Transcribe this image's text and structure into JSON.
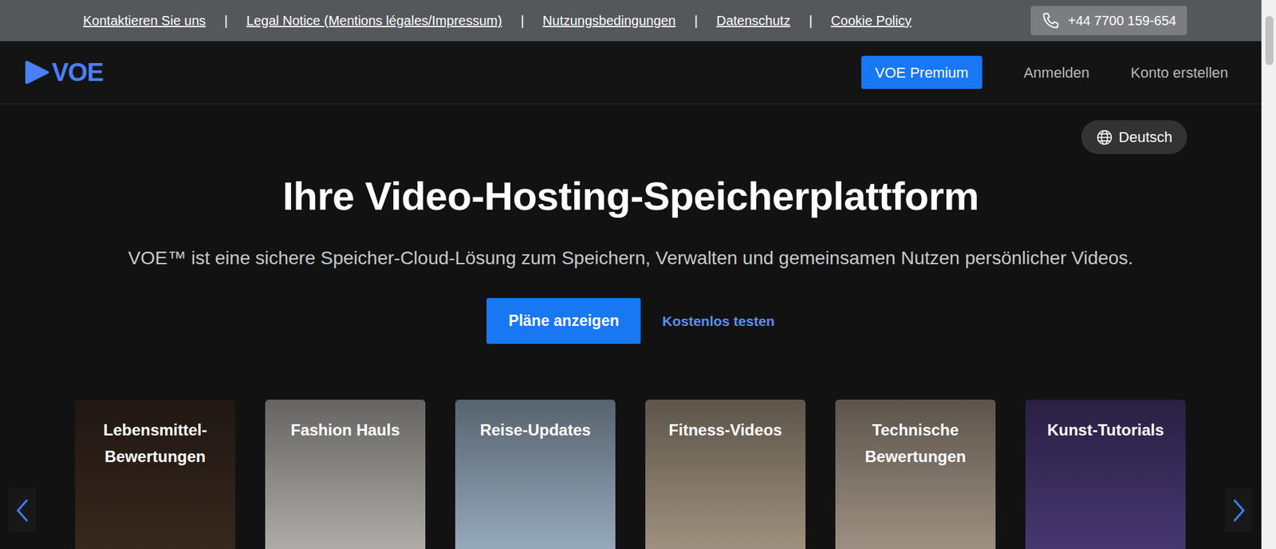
{
  "top_bar": {
    "links": [
      {
        "label": "Kontaktieren Sie uns"
      },
      {
        "label": "Legal Notice (Mentions légales/Impressum)"
      },
      {
        "label": "Nutzungsbedingungen"
      },
      {
        "label": "Datenschutz"
      },
      {
        "label": "Cookie Policy"
      }
    ],
    "separator": "|",
    "phone": "+44 7700 159-654"
  },
  "logo": "VOE",
  "nav": {
    "premium": "VOE Premium",
    "login": "Anmelden",
    "signup": "Konto erstellen"
  },
  "language": "Deutsch",
  "hero": {
    "title": "Ihre Video-Hosting-Speicherplattform",
    "subtitle": "VOE™ ist eine sichere Speicher-Cloud-Lösung zum Speichern, Verwalten und gemeinsamen Nutzen persönlicher Videos.",
    "primary_button": "Pläne anzeigen",
    "secondary_button": "Kostenlos testen"
  },
  "carousel": {
    "cards": [
      {
        "title": "Lebensmittel-Bewertungen",
        "color": "#3a2a20"
      },
      {
        "title": "Fashion Hauls",
        "color": "#b9b6b2"
      },
      {
        "title": "Reise-Updates",
        "color": "#9fb4c8"
      },
      {
        "title": "Fitness-Videos",
        "color": "#a89a86"
      },
      {
        "title": "Technische Bewertungen",
        "color": "#a7998a"
      },
      {
        "title": "Kunst-Tutorials",
        "color": "#4b3a78"
      }
    ]
  }
}
